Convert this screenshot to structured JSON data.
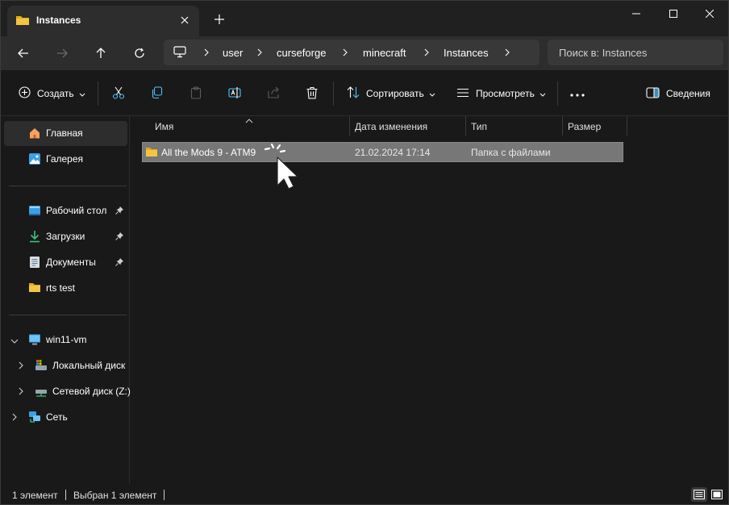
{
  "tab": {
    "title": "Instances",
    "icon": "folder-icon"
  },
  "window_controls": [
    "minimize-icon",
    "maximize-icon",
    "close-icon"
  ],
  "breadcrumb": [
    "user",
    "curseforge",
    "minecraft",
    "Instances"
  ],
  "search": {
    "placeholder": "Поиск в: Instances"
  },
  "toolbar": {
    "create_label": "Создать",
    "sort_label": "Сортировать",
    "view_label": "Просмотреть",
    "details_label": "Сведения"
  },
  "sidebar": {
    "items": [
      {
        "label": "Главная",
        "icon": "home-icon"
      },
      {
        "label": "Галерея",
        "icon": "gallery-icon"
      },
      {
        "label": "Рабочий стол",
        "icon": "desktop-icon",
        "pinned": true
      },
      {
        "label": "Загрузки",
        "icon": "downloads-icon",
        "pinned": true
      },
      {
        "label": "Документы",
        "icon": "documents-icon",
        "pinned": true
      },
      {
        "label": "rts test",
        "icon": "folder-icon"
      },
      {
        "label": "win11-vm",
        "icon": "computer-icon"
      },
      {
        "label": "Локальный диск",
        "icon": "local-disk-icon"
      },
      {
        "label": "Сетевой диск (Z:)",
        "icon": "network-drive-icon"
      },
      {
        "label": "Сеть",
        "icon": "network-icon"
      }
    ]
  },
  "columns": [
    "Имя",
    "Дата изменения",
    "Тип",
    "Размер"
  ],
  "files": [
    {
      "name": "All the Mods 9 - ATM9",
      "modified": "21.02.2024 17:14",
      "type": "Папка с файлами",
      "size": ""
    }
  ],
  "status": {
    "count": "1 элемент",
    "selected": "Выбран 1 элемент"
  },
  "colors": {
    "folder": "#f4c542",
    "accent": "#4cc2ff",
    "selection": "#777777"
  }
}
